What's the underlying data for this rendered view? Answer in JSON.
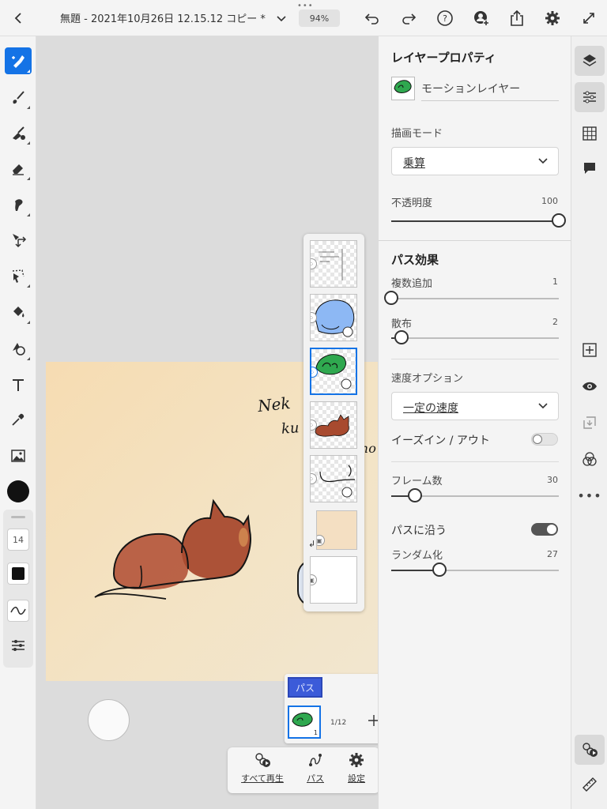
{
  "document": {
    "title": "無題 - 2021年10月26日 12.15.12 コピー *",
    "zoom": "94%"
  },
  "toolbar": {
    "brush_size": "14",
    "color": "#111111"
  },
  "canvas": {
    "handwriting_line1": "Nek",
    "handwriting_line2": "ku",
    "handwriting_line3": "ho"
  },
  "panel": {
    "title": "レイヤープロパティ",
    "layer_name": "モーションレイヤー",
    "blend_mode_label": "描画モード",
    "blend_mode_value": "乗算",
    "opacity_label": "不透明度",
    "opacity_value": "100",
    "path_effects_title": "パス効果",
    "multi_add_label": "複数追加",
    "multi_add_value": "1",
    "scatter_label": "散布",
    "scatter_value": "2",
    "speed_label": "速度オプション",
    "speed_value": "一定の速度",
    "ease_label": "イーズイン / アウト",
    "ease_on": false,
    "frames_label": "フレーム数",
    "frames_value": "30",
    "follow_path_label": "パスに沿う",
    "follow_path_on": true,
    "random_label": "ランダム化",
    "random_value": "27"
  },
  "timeline": {
    "path_tag": "パス",
    "frame_number": "1",
    "frame_counter": "1/12"
  },
  "bottom_bar": {
    "play_all": "すべて再生",
    "path": "パス",
    "settings": "設定"
  },
  "colors": {
    "accent": "#1473e6",
    "toggle_on": "#555555",
    "leaf_green": "#2fa84f",
    "cat_brown": "#a54a2f"
  }
}
